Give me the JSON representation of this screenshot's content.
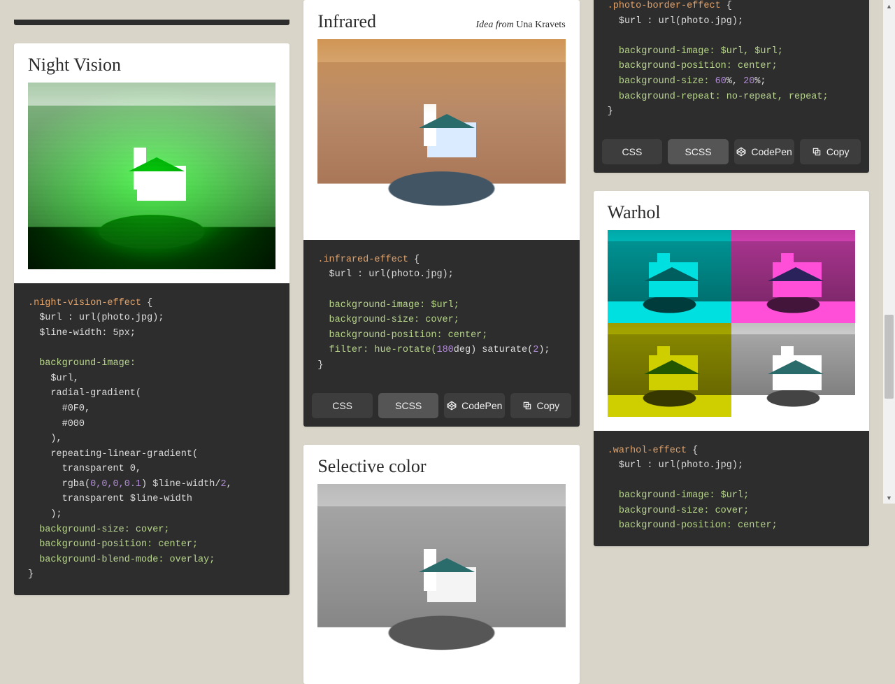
{
  "buttons": {
    "css": "CSS",
    "scss": "SCSS",
    "codepen": "CodePen",
    "copy": "Copy"
  },
  "credit_prefix": "Idea from ",
  "cards": {
    "night_vision": {
      "title": "Night Vision",
      "code": {
        "selector": ".night-vision-effect",
        "url_line": "  $url : url(photo.jpg);",
        "lw_line": "  $line-width: 5px;",
        "bg_image": "  background-image:",
        "l1": "    $url,",
        "l2": "    radial-gradient(",
        "l3": "      #0F0,",
        "l4": "      #000",
        "l5": "    ),",
        "l6": "    repeating-linear-gradient(",
        "l7": "      transparent 0,",
        "l8_a": "      rgba(",
        "l8_b": "0,0,0,0.1",
        "l8_c": ") $line-width/",
        "l8_d": "2",
        "l8_e": ",",
        "l9": "      transparent $line-width",
        "l10": "    );",
        "bs": "  background-size: cover;",
        "bp": "  background-position: center;",
        "bbm": "  background-blend-mode: overlay;"
      }
    },
    "infrared": {
      "title": "Infrared",
      "credit": "Una Kravets",
      "code": {
        "selector": ".infrared-effect",
        "url_line": "  $url : url(photo.jpg);",
        "bi": "  background-image: $url;",
        "bs": "  background-size: cover;",
        "bp": "  background-position: center;",
        "f_a": "  filter: hue-rotate(",
        "f_b": "180",
        "f_c": "deg) saturate(",
        "f_d": "2",
        "f_e": ");"
      }
    },
    "selective": {
      "title": "Selective color"
    },
    "photo_border": {
      "code": {
        "selector": ".photo-border-effect",
        "url_line": "  $url : url(photo.jpg);",
        "bi": "  background-image: $url, $url;",
        "bp": "  background-position: center;",
        "bs_a": "  background-size: ",
        "bs_b": "60",
        "bs_c": "%, ",
        "bs_d": "20",
        "bs_e": "%;",
        "br": "  background-repeat: no-repeat, repeat;"
      }
    },
    "warhol": {
      "title": "Warhol",
      "code": {
        "selector": ".warhol-effect",
        "url_line": "  $url : url(photo.jpg);",
        "bi": "  background-image: $url;",
        "bs": "  background-size: cover;",
        "bp": "  background-position: center;"
      }
    }
  }
}
